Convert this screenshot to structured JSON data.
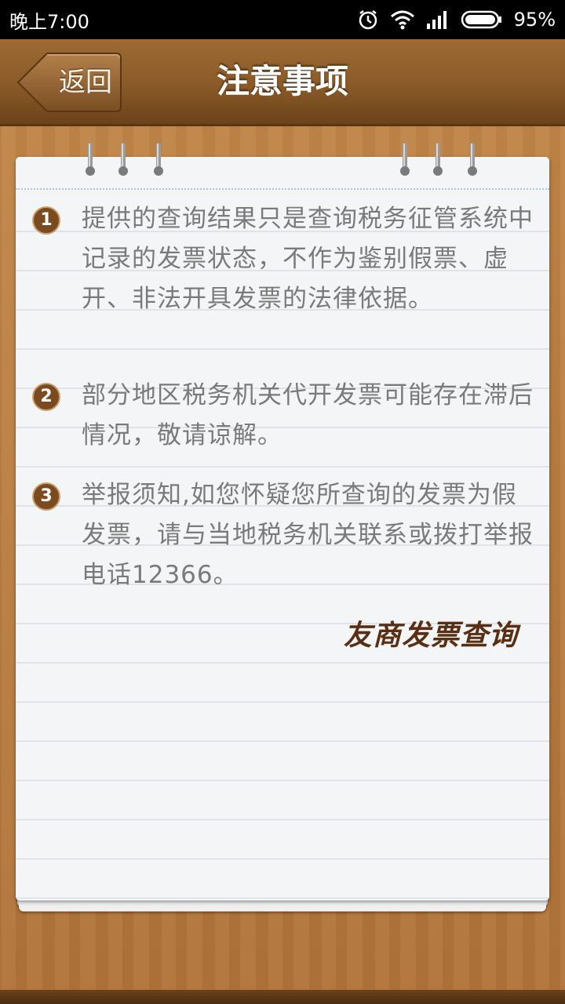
{
  "status_bar": {
    "time": "晚上7:00",
    "battery_percent": "95%",
    "icons": [
      "alarm-icon",
      "wifi-icon",
      "signal-icon",
      "battery-icon"
    ]
  },
  "header": {
    "back_label": "返回",
    "title": "注意事项"
  },
  "notes": [
    {
      "number": "1",
      "text": "提供的查询结果只是查询税务征管系统中记录的发票状态，不作为鉴别假票、虚开、非法开具发票的法律依据。"
    },
    {
      "number": "2",
      "text": "部分地区税务机关代开发票可能存在滞后情况，敬请谅解。"
    },
    {
      "number": "3",
      "text": "举报须知,如您怀疑您所查询的发票为假发票，请与当地税务机关联系或拨打举报电话12366。"
    }
  ],
  "brand": {
    "logo_text": "友商发票查询"
  },
  "colors": {
    "header_brown": "#8a5a28",
    "wood": "#b67a3c",
    "paper": "#f4f5f7",
    "note_text": "#7a7a7a",
    "badge": "#7b4a1e",
    "logo": "#5a2e12"
  }
}
